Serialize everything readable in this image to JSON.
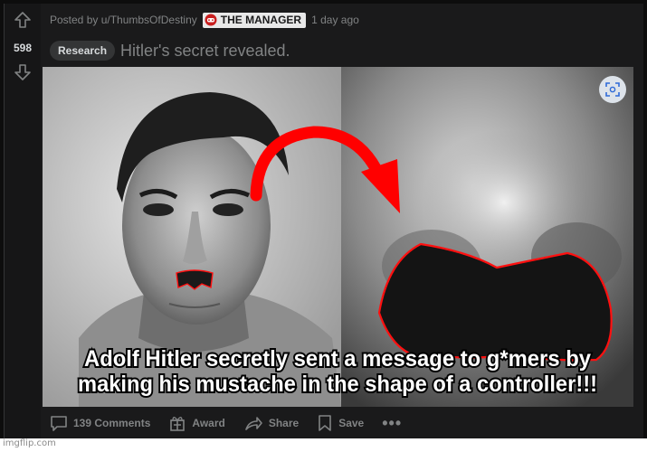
{
  "post": {
    "vote_count": "598",
    "posted_by": "Posted by u/ThumbsOfDestiny",
    "user_flair": "THE MANAGER",
    "time_ago": "1 day ago",
    "flair": "Research",
    "title": "Hitler's secret revealed.",
    "image_caption_line1": "Adolf Hitler secretly sent a message to g*mers by",
    "image_caption_line2": "making his mustache in the shape of a controller!!!"
  },
  "actions": {
    "comments": "139 Comments",
    "award": "Award",
    "share": "Share",
    "save": "Save",
    "more": "•••"
  },
  "watermark": "imgflip.com",
  "colors": {
    "background": "#1a1a1b",
    "meta_text": "#818384",
    "highlight": "#ff0000"
  },
  "icons": {
    "upvote": "arrow-up-icon",
    "downvote": "arrow-down-icon",
    "comments": "comment-icon",
    "award": "gift-icon",
    "share": "share-icon",
    "save": "bookmark-icon",
    "expand": "expand-icon"
  }
}
